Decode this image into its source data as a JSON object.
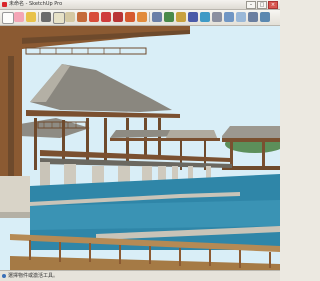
{
  "window": {
    "title": "未命名 - SketchUp Pro"
  },
  "status": {
    "text": "選擇物件或激活工具。"
  },
  "toolbar_icons": [
    "select-icon",
    "eraser-icon",
    "paint-bucket-icon",
    "line-icon",
    "rectangle-icon",
    "circle-icon",
    "arc-icon",
    "push-pull-icon",
    "offset-icon",
    "move-icon",
    "rotate-icon",
    "scale-icon",
    "follow-me-icon",
    "tape-measure-icon",
    "text-icon",
    "axes-icon",
    "orbit-icon",
    "pan-icon",
    "zoom-icon",
    "zoom-extents-icon",
    "iso-view-icon",
    "top-view-icon",
    "front-view-icon",
    "right-view-icon",
    "xray-icon",
    "wireframe-icon",
    "hidden-line-icon",
    "shaded-icon",
    "textured-icon",
    "monochrome-icon",
    "section-plane-icon",
    "warehouse-icon",
    "extension-icon"
  ],
  "colors": {
    "sky": "#d9eef7",
    "water": "#2f86a8",
    "wood": "#8b5a32",
    "stone": "#c9c4b8"
  }
}
